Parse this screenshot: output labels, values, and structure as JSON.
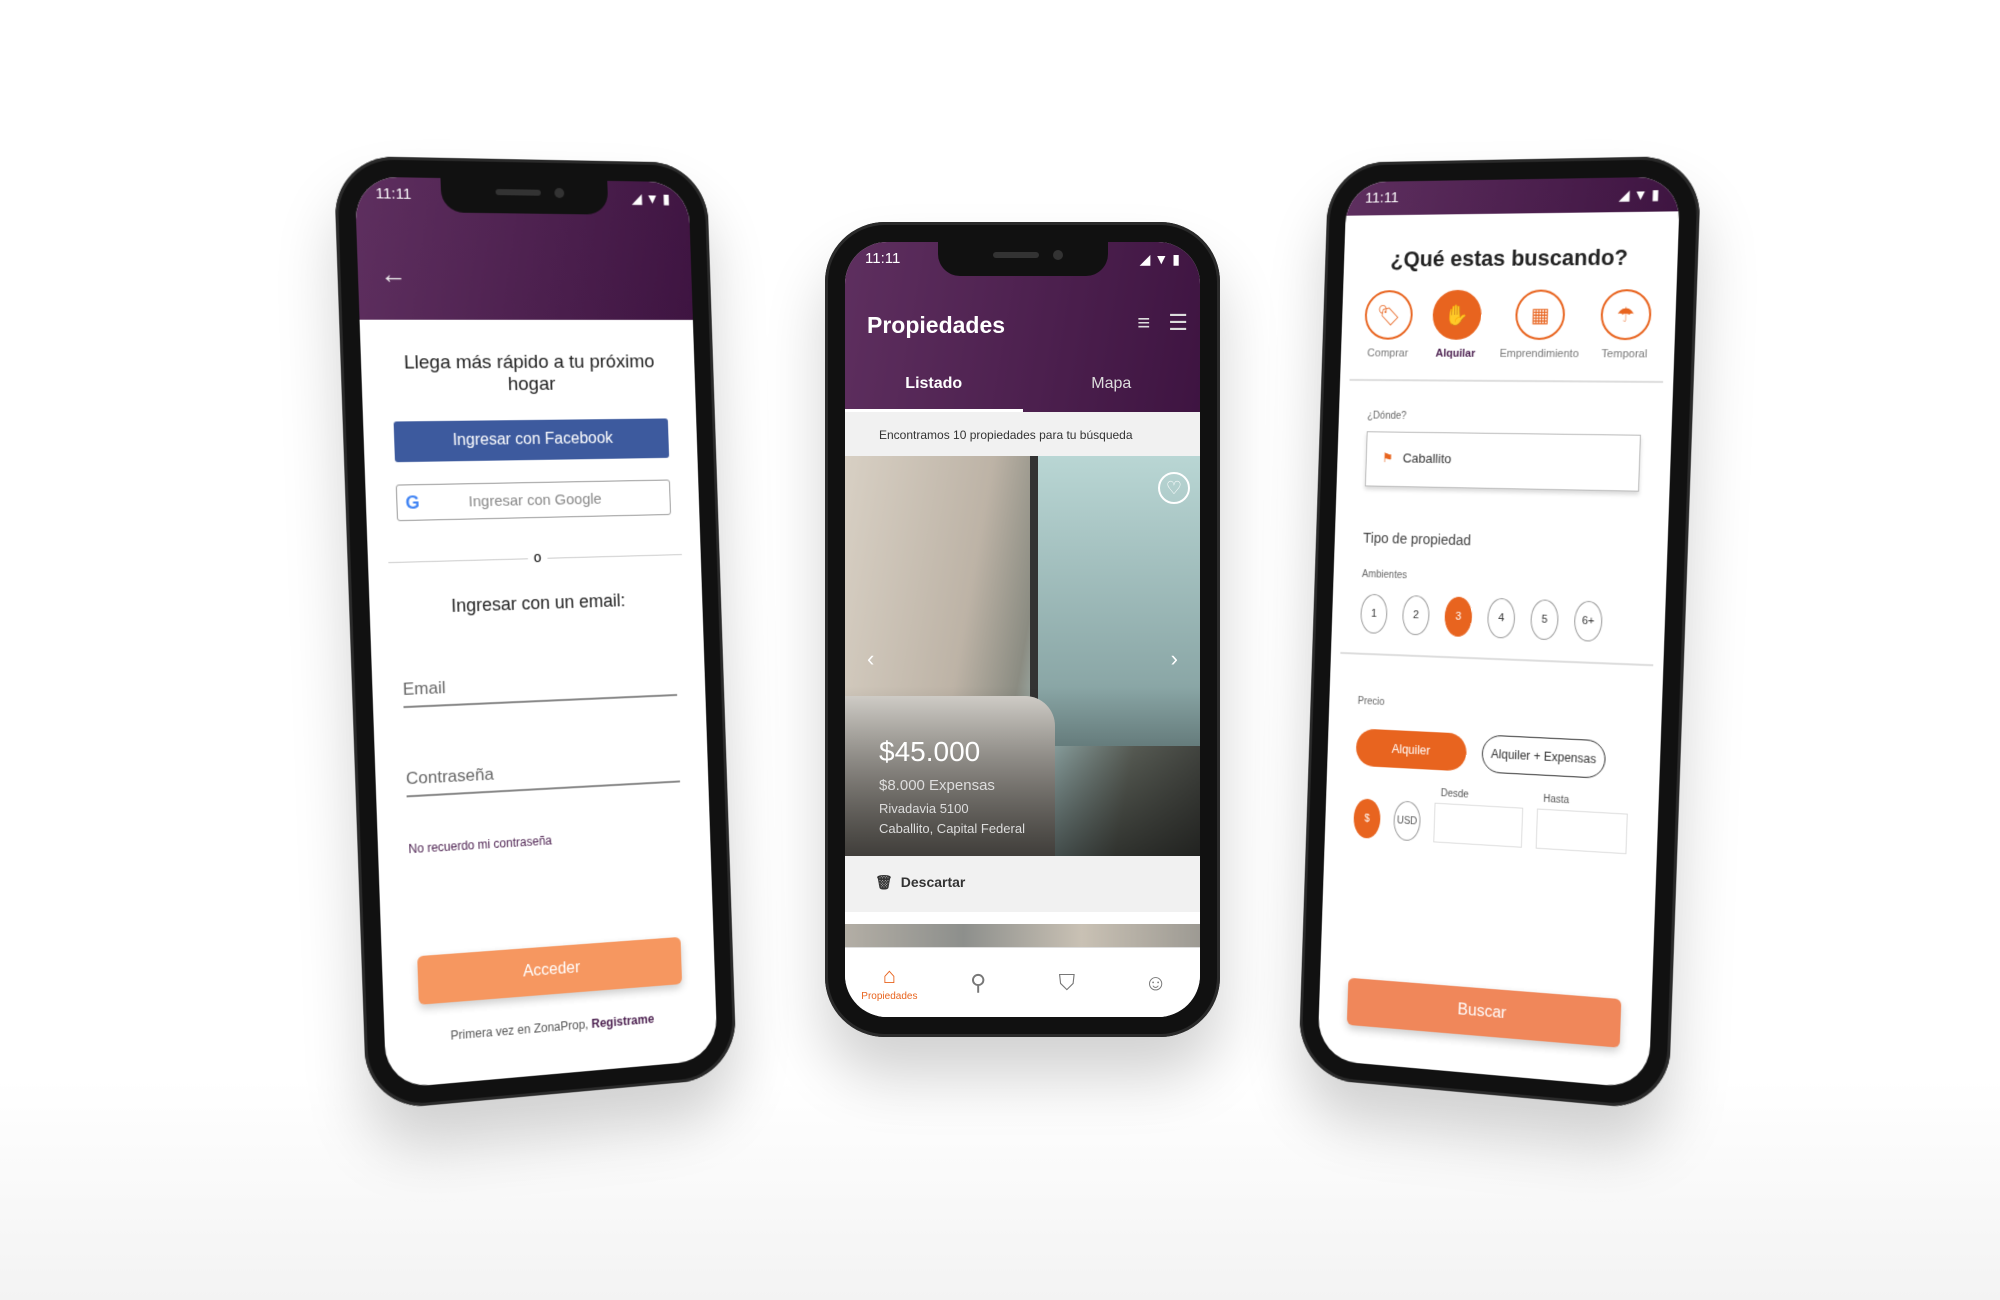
{
  "status": {
    "time": "11:11"
  },
  "login": {
    "title": "Llega más rápido a tu próximo hogar",
    "facebook_label": "Ingresar con Facebook",
    "google_label": "Ingresar con Google",
    "or_text": "o",
    "email_title": "Ingresar con un email:",
    "email_placeholder": "Email",
    "password_placeholder": "Contraseña",
    "forgot_label": "No recuerdo mi contraseña",
    "submit_label": "Acceder",
    "register_text": "Primera vez en ZonaProp,",
    "register_link": "Registrame"
  },
  "listing": {
    "title": "Propiedades",
    "tabs": [
      {
        "label": "Listado",
        "active": true
      },
      {
        "label": "Mapa",
        "active": false
      }
    ],
    "result_text": "Encontramos 10 propiedades para tu búsqueda",
    "card": {
      "price": "$45.000",
      "expensas": "$8.000 Expensas",
      "address_line1": "Rivadavia 5100",
      "address_line2": "Caballito, Capital Federal"
    },
    "discard_label": "Descartar",
    "bottom_nav": [
      {
        "label": "Propiedades",
        "icon": "home-icon",
        "active": true
      },
      {
        "label": "",
        "icon": "search-icon",
        "active": false
      },
      {
        "label": "",
        "icon": "shield-icon",
        "active": false
      },
      {
        "label": "",
        "icon": "user-icon",
        "active": false
      }
    ]
  },
  "search": {
    "title": "¿Qué estas buscando?",
    "operations": [
      {
        "label": "Comprar",
        "icon": "tag-icon",
        "active": false
      },
      {
        "label": "Alquilar",
        "icon": "hand-key-icon",
        "active": true
      },
      {
        "label": "Emprendimiento",
        "icon": "building-icon",
        "active": false
      },
      {
        "label": "Temporal",
        "icon": "umbrella-icon",
        "active": false
      }
    ],
    "where_label": "¿Dónde?",
    "where_value": "Caballito",
    "property_type_label": "Tipo de propiedad",
    "rooms_label": "Ambientes",
    "rooms": [
      "1",
      "2",
      "3",
      "4",
      "5",
      "6+"
    ],
    "rooms_selected": "3",
    "price_label": "Precio",
    "price_options": [
      "Alquiler",
      "Alquiler + Expensas"
    ],
    "currency_options": [
      "$",
      "USD"
    ],
    "from_label": "Desde",
    "to_label": "Hasta",
    "submit_label": "Buscar"
  },
  "colors": {
    "purple": "#4a1e4e",
    "orange": "#e8641f",
    "light_orange": "#f69760",
    "facebook": "#3d5a9e"
  }
}
